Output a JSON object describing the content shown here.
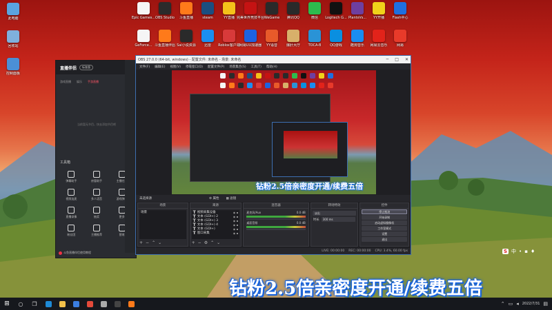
{
  "desktop": {
    "left_icons": [
      {
        "label": "此电脑",
        "icon": "computer-icon",
        "color": "#5aa4e0"
      },
      {
        "label": "回收站",
        "icon": "recycle-bin-icon",
        "color": "#7fb0dd"
      },
      {
        "label": "控制面板",
        "icon": "control-panel-icon",
        "color": "#4b8fd6"
      }
    ],
    "row1_icons": [
      {
        "label": "Epic Games...",
        "icon": "file-icon",
        "color": "#f5f5f5"
      },
      {
        "label": "OBS Studio",
        "icon": "obs-icon",
        "color": "#2b2b2b"
      },
      {
        "label": "斗鱼直播",
        "icon": "douyu-icon",
        "color": "#ff7a1a"
      },
      {
        "label": "steam",
        "icon": "steam-icon",
        "color": "#1b4e80"
      },
      {
        "label": "YY直播",
        "icon": "yy-icon",
        "color": "#f4c21a"
      },
      {
        "label": "完美世界竞技平台",
        "icon": "perfect-world-icon",
        "color": "#c51313"
      },
      {
        "label": "WeGame",
        "icon": "wegame-icon",
        "color": "#2a2a2a"
      },
      {
        "label": "腾讯QQ",
        "icon": "qq-icon",
        "color": "#2a2a2a"
      },
      {
        "label": "微信",
        "icon": "wechat-icon",
        "color": "#2dbc4e"
      },
      {
        "label": "Logitech G...",
        "icon": "logitech-icon",
        "color": "#111111"
      },
      {
        "label": "PlantsVs...",
        "icon": "plants-vs-zombies-icon",
        "color": "#6e3fa0"
      },
      {
        "label": "YY开播",
        "icon": "yy-live-icon",
        "color": "#f0d21a"
      },
      {
        "label": "Flash中心",
        "icon": "flash-icon",
        "color": "#1e6fe0"
      }
    ],
    "row2_icons": [
      {
        "label": "GeForce...",
        "icon": "file-icon",
        "color": "#f5f5f5"
      },
      {
        "label": "斗鱼直播伴侣",
        "icon": "douyu-companion-icon",
        "color": "#ff7a1a"
      },
      {
        "label": "Sai小说资源",
        "icon": "sai-icon",
        "color": "#2a2a2a"
      },
      {
        "label": "迅雷",
        "icon": "xunlei-icon",
        "color": "#1b8ef0"
      },
      {
        "label": "Roblox客户端",
        "icon": "roblox-icon",
        "color": "#d83a3a"
      },
      {
        "label": "网易UU加速器",
        "icon": "uu-icon",
        "color": "#1d62e0"
      },
      {
        "label": "YY语音",
        "icon": "yy-voice-icon",
        "color": "#e85a2a"
      },
      {
        "label": "爆肝大厅",
        "icon": "game-hall-icon",
        "color": "#d8b06a"
      },
      {
        "label": "TOCA-B",
        "icon": "toca-icon",
        "color": "#2a93d6"
      },
      {
        "label": "QQ游戏",
        "icon": "qq-game-icon",
        "color": "#0a8fe0"
      },
      {
        "label": "酷狗音乐",
        "icon": "kugou-icon",
        "color": "#1a8df0"
      },
      {
        "label": "网易云音乐",
        "icon": "netease-music-icon",
        "color": "#e2231a"
      },
      {
        "label": "网易",
        "icon": "netease-icon",
        "color": "#e83a2a"
      }
    ]
  },
  "live_app": {
    "logo": "直播伴侣",
    "version": "标准版",
    "tabs": [
      "游戏直播",
      "娱乐",
      "手游直播"
    ],
    "empty_hint": "当前暂无节目，快去添加节目吧",
    "tools_title": "工具箱",
    "tools": [
      {
        "label": "弹幕助手",
        "icon": "danmaku-icon"
      },
      {
        "label": "房管助手",
        "icon": "admin-icon"
      },
      {
        "label": "主播任务",
        "icon": "task-icon"
      },
      {
        "label": "视频连麦",
        "icon": "video-link-icon"
      },
      {
        "label": "多人语音",
        "icon": "voice-icon"
      },
      {
        "label": "游戏弹幕",
        "icon": "game-danmaku-icon"
      },
      {
        "label": "直播录像",
        "icon": "record-icon"
      },
      {
        "label": "抽奖",
        "icon": "lottery-icon"
      },
      {
        "label": "更多",
        "icon": "more-icon"
      },
      {
        "label": "粉丝团",
        "icon": "fans-icon"
      },
      {
        "label": "主播推荐",
        "icon": "recommend-icon"
      },
      {
        "label": "营收",
        "icon": "revenue-icon"
      }
    ],
    "footer": "斗鱼直播伴侣使用教程"
  },
  "obs": {
    "title": "OBS 27.0.0 (64-bit, windows) - 配置文件: 未命名 - 场景: 未命名",
    "menu": [
      "文件(F)",
      "编辑(E)",
      "视图(V)",
      "停靠窗口(D)",
      "配置文件(P)",
      "场景集合(S)",
      "工具(T)",
      "帮助(H)"
    ],
    "preview_caption": "钻粉2.5倍亲密度开通/续费五倍",
    "no_source": "未选择源",
    "prop_btn": "属性",
    "filter_btn": "滤镜",
    "docks": {
      "scenes": {
        "title": "场景",
        "items": [
          "场景"
        ]
      },
      "sources": {
        "title": "来源",
        "items": [
          "视频采集设备",
          "文本 (GDI+) 2",
          "文本 (GDI+) 3",
          "文本 (GDI+) 4",
          "文本 (GDI+)",
          "窗口采集"
        ]
      },
      "mixer": {
        "title": "混音器",
        "channels": [
          {
            "name": "麦克风/Aux",
            "db": "0.0 dB"
          },
          {
            "name": "桌面音频",
            "db": "0.0 dB"
          }
        ]
      },
      "transitions": {
        "title": "转场特效",
        "type": "淡出",
        "duration_label": "时长",
        "duration": "300 ms"
      },
      "controls": {
        "title": "控件",
        "buttons": [
          "停止推流",
          "开始录制",
          "启动虚拟摄像机",
          "工作室模式",
          "设置",
          "退出"
        ]
      }
    },
    "status": [
      "LIVE: 00:00:00",
      "REC: 00:00:00",
      "CPU: 3.4%, 60.00 fps"
    ]
  },
  "overlay_caption": "钻粉2.5倍亲密度开通/续费五倍",
  "tray_ime": "中",
  "taskbar": {
    "apps": [
      {
        "name": "start-icon",
        "color": "#ffffff"
      },
      {
        "name": "search-icon",
        "color": "#dddddd"
      },
      {
        "name": "task-view-icon",
        "color": "#dddddd"
      },
      {
        "name": "edge-icon",
        "color": "#1e8ad6"
      },
      {
        "name": "explorer-icon",
        "color": "#f2c04a"
      },
      {
        "name": "store-icon",
        "color": "#3b7ee0"
      },
      {
        "name": "chrome-icon",
        "color": "#e44a3a"
      },
      {
        "name": "settings-icon",
        "color": "#aaaaaa"
      },
      {
        "name": "obs-icon",
        "color": "#444444"
      },
      {
        "name": "douyu-icon",
        "color": "#ff7a1a"
      }
    ],
    "clock_time": "",
    "clock_date": "2022/7/31"
  }
}
